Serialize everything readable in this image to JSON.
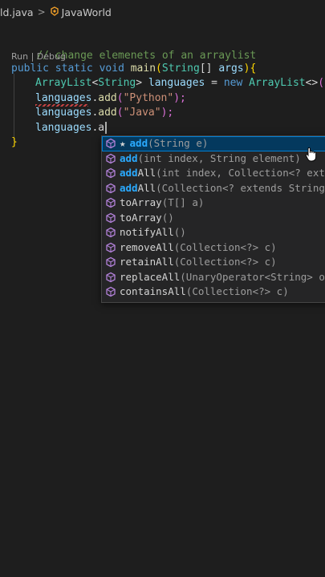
{
  "breadcrumb": {
    "file": "ld.java",
    "separator": ">",
    "class_name": "JavaWorld"
  },
  "editor": {
    "comment": "// change elemenets of an arraylist",
    "codelens": {
      "run": "Run",
      "sep": " | ",
      "debug": "Debug"
    },
    "main_sig": {
      "kw1": "public",
      "kw2": "static",
      "kw3": "void",
      "fn": "main",
      "open": "(",
      "type": "String",
      "brackets": "[]",
      "param": "args",
      "close": ")",
      "brace": "{"
    },
    "decl": {
      "type": "ArrayList",
      "lt": "<",
      "generic": "String",
      "gt": ">",
      "var": "languages",
      "eq": " = ",
      "kw": "new",
      "ctor": "ArrayList",
      "diamond": "<>",
      "parens": "()",
      "semi": ";"
    },
    "add1": {
      "var": "languages",
      "dot": ".",
      "fn": "add",
      "open": "(",
      "str": "\"Python\"",
      "close": ");"
    },
    "add2": {
      "var": "languages",
      "dot": ".",
      "fn": "add",
      "open": "(",
      "str": "\"Java\"",
      "close": ");"
    },
    "typing": {
      "var": "languages",
      "dot": ".",
      "partial": "a"
    },
    "close_brace": "}"
  },
  "suggestions": [
    {
      "star": "★",
      "match": "add",
      "rest": "",
      "sig": "(String e)",
      "selected": true
    },
    {
      "star": "",
      "match": "add",
      "rest": "",
      "sig": "(int index, String element)",
      "selected": false
    },
    {
      "star": "",
      "match": "add",
      "rest": "All",
      "sig": "(int index, Collection<? exte",
      "selected": false
    },
    {
      "star": "",
      "match": "add",
      "rest": "All",
      "sig": "(Collection<? extends String>",
      "selected": false
    },
    {
      "star": "",
      "match": "",
      "rest": "toArray",
      "sig": "(T[] a)",
      "selected": false
    },
    {
      "star": "",
      "match": "",
      "rest": "toArray",
      "sig": "()",
      "selected": false
    },
    {
      "star": "",
      "match": "",
      "rest": "notifyAll",
      "sig": "()",
      "selected": false
    },
    {
      "star": "",
      "match": "",
      "rest": "removeAll",
      "sig": "(Collection<?> c)",
      "selected": false
    },
    {
      "star": "",
      "match": "",
      "rest": "retainAll",
      "sig": "(Collection<?> c)",
      "selected": false
    },
    {
      "star": "",
      "match": "",
      "rest": "replaceAll",
      "sig": "(UnaryOperator<String> op",
      "selected": false
    },
    {
      "star": "",
      "match": "",
      "rest": "containsAll",
      "sig": "(Collection<?> c)",
      "selected": false
    }
  ],
  "colors": {
    "method_icon": "#b180d7",
    "match": "#2aaaff",
    "selection": "#04395e",
    "background": "#1e1e1e"
  },
  "icons": {
    "suggestion": "method-cube-icon",
    "breadcrumb": "class-icon",
    "pointer": "mouse-pointer-icon"
  }
}
